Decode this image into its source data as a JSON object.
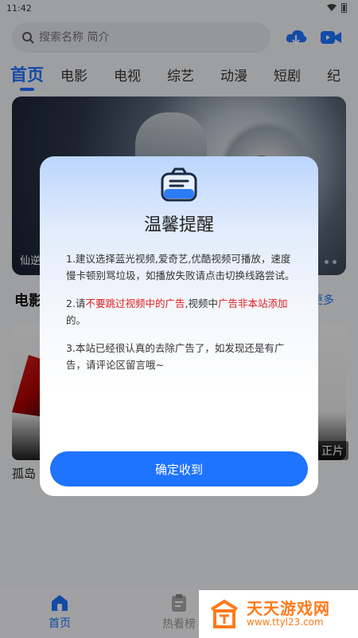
{
  "status_bar": {
    "time": "11:42"
  },
  "search": {
    "placeholder": "搜索名称 简介"
  },
  "top_icons": {
    "download": "cloud-download-icon",
    "video": "video-camera-icon"
  },
  "tabs": [
    {
      "label": "首页",
      "active": true
    },
    {
      "label": "电影",
      "active": false
    },
    {
      "label": "电视",
      "active": false
    },
    {
      "label": "综艺",
      "active": false
    },
    {
      "label": "动漫",
      "active": false
    },
    {
      "label": "短剧",
      "active": false
    },
    {
      "label": "纪",
      "active": false
    }
  ],
  "banner": {
    "caption": "仙逆"
  },
  "section": {
    "title": "电影",
    "more": "更多"
  },
  "movie": {
    "badge": "正片",
    "title": "孤岛"
  },
  "dialog": {
    "title": "温馨提醒",
    "item1": "1.建议选择蓝光视频,爱奇艺,优酷视频可播放，速度慢卡顿别骂垃圾，如播放失败请点击切换线路尝试。",
    "item2_prefix": "2.请",
    "item2_red1": "不要跳过视频中的广告",
    "item2_mid": ",视频中",
    "item2_red2": "广告非本站添加",
    "item2_suffix": "的。",
    "item3": "3.本站已经很认真的去除广告了，如发现还是有广告，请评论区留言哦~",
    "confirm": "确定收到"
  },
  "bottom_nav": [
    {
      "label": "首页",
      "icon": "home-icon",
      "active": true
    },
    {
      "label": "热看榜",
      "icon": "clipboard-icon",
      "active": false
    }
  ],
  "watermark": {
    "main": "天天游戏网",
    "url": "www.ttyl23.com"
  },
  "colors": {
    "accent": "#1e73ff",
    "warning": "#e02020"
  }
}
